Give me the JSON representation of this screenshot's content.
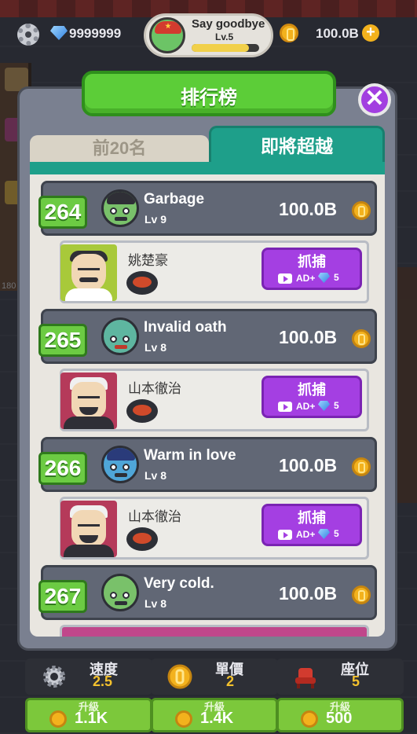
{
  "hud": {
    "gems": "9999999",
    "player_name": "Say goodbye",
    "player_level": "Lv.5",
    "xp_fraction": 0.85,
    "money": "100.0B"
  },
  "panel": {
    "title": "排行榜",
    "close_symbol": "✕",
    "tabs": [
      {
        "label": "前20名",
        "active": false
      },
      {
        "label": "即將超越",
        "active": true
      }
    ]
  },
  "entries": [
    {
      "rank": "264",
      "name": "Garbage",
      "level": "Lv 9",
      "money": "100.0B",
      "visitor": {
        "name": "姚楚豪",
        "avatar": "chef",
        "action": "抓捕",
        "ad_label": "AD+",
        "gem_count": "5"
      }
    },
    {
      "rank": "265",
      "name": "Invalid oath",
      "level": "Lv 8",
      "money": "100.0B",
      "visitor": {
        "name": "山本徹治",
        "avatar": "boss",
        "action": "抓捕",
        "ad_label": "AD+",
        "gem_count": "5"
      }
    },
    {
      "rank": "266",
      "name": "Warm in love",
      "level": "Lv 8",
      "money": "100.0B",
      "visitor": {
        "name": "山本徹治",
        "avatar": "boss",
        "action": "抓捕",
        "ad_label": "AD+",
        "gem_count": "5"
      }
    },
    {
      "rank": "267",
      "name": "Very cold.",
      "level": "Lv 8",
      "money": "100.0B"
    }
  ],
  "upgrades": [
    {
      "label": "速度",
      "value": "2.5",
      "button_label": "升級",
      "price": "1.1K",
      "icon": "gear-icon"
    },
    {
      "label": "單價",
      "value": "2",
      "button_label": "升級",
      "price": "1.4K",
      "icon": "coin-icon"
    },
    {
      "label": "座位",
      "value": "5",
      "button_label": "升級",
      "price": "500",
      "icon": "chair-icon"
    }
  ],
  "side_text": "180",
  "colors": {
    "accent_green": "#5ccd38",
    "tab_teal": "#1e9f8a",
    "catch_purple": "#a43fe2",
    "coin_gold": "#f3b21d"
  }
}
